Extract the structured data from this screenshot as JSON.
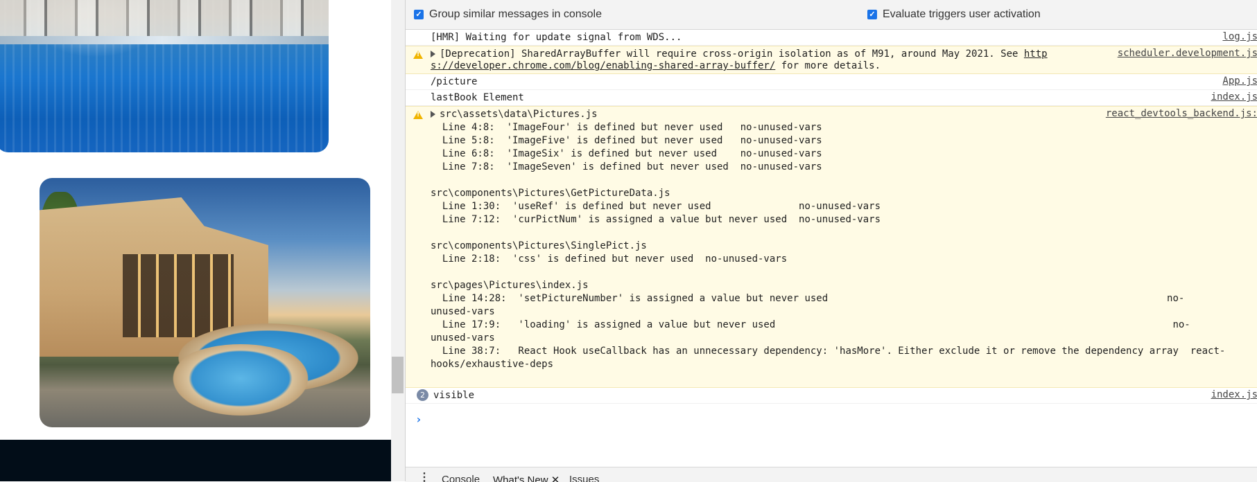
{
  "devtools": {
    "settings": {
      "group_similar": {
        "label": "Group similar messages in console",
        "checked": true
      },
      "evaluate_triggers": {
        "label": "Evaluate triggers user activation",
        "checked": true
      }
    },
    "console": {
      "messages": [
        {
          "text": "[HMR] Waiting for update signal from WDS...",
          "source": "log.js"
        },
        {
          "text_a": "[Deprecation] SharedArrayBuffer will require cross-origin isolation as of M91, around May 2021. See ",
          "link_a": "http",
          "link_b": "s://developer.chrome.com/blog/enabling-shared-array-buffer/",
          "text_b": " for more details.",
          "source": "scheduler.development.js"
        },
        {
          "text": "/picture",
          "source": "App.js"
        },
        {
          "text": "lastBook Element",
          "source": "index.js"
        },
        {
          "text": "src\\assets\\data\\Pictures.js",
          "source": "react_devtools_backend.js:",
          "lines": [
            "  Line 4:8:  'ImageFour' is defined but never used   no-unused-vars",
            "  Line 5:8:  'ImageFive' is defined but never used   no-unused-vars",
            "  Line 6:8:  'ImageSix' is defined but never used    no-unused-vars",
            "  Line 7:8:  'ImageSeven' is defined but never used  no-unused-vars",
            "",
            "src\\components\\Pictures\\GetPictureData.js",
            "  Line 1:30:  'useRef' is defined but never used               no-unused-vars",
            "  Line 7:12:  'curPictNum' is assigned a value but never used  no-unused-vars",
            "",
            "src\\components\\Pictures\\SinglePict.js",
            "  Line 2:18:  'css' is defined but never used  no-unused-vars",
            "",
            "src\\pages\\Pictures\\index.js",
            "  Line 14:28:  'setPictureNumber' is assigned a value but never used                                                          no-",
            "unused-vars",
            "  Line 17:9:   'loading' is assigned a value but never used                                                                    no-",
            "unused-vars",
            "  Line 38:7:   React Hook useCallback has an unnecessary dependency: 'hasMore'. Either exclude it or remove the dependency array  react-",
            "hooks/exhaustive-deps"
          ]
        },
        {
          "count": "2",
          "text": "visible",
          "source": "index.js"
        }
      ],
      "prompt_symbol": "›"
    },
    "drawer": {
      "menu_icon": "⋮",
      "tabs": [
        "Console",
        "What's New",
        "Issues"
      ],
      "close_symbol": "✕"
    }
  }
}
